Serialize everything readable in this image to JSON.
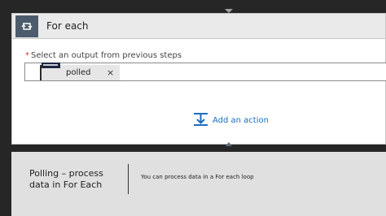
{
  "colors": {
    "background": "#262626",
    "card_header": "#eaeaea",
    "loop_tile": "#4d5c6c",
    "link": "#1b6ec2",
    "required": "#d13438",
    "caption_panel": "#e0e0e0"
  },
  "card": {
    "icon": "loop-icon",
    "title": "For each"
  },
  "field": {
    "required_marker": "*",
    "label": "Select an output from previous steps",
    "token": {
      "logo_icon": "connector-logo-icon",
      "text": "polled",
      "remove_icon": "close-icon",
      "remove_label": "×"
    }
  },
  "add_action": {
    "icon": "add-action-icon",
    "label": "Add an action"
  },
  "caption": {
    "title": "Polling – process data in For Each",
    "note": "You can process data in a For each loop"
  }
}
